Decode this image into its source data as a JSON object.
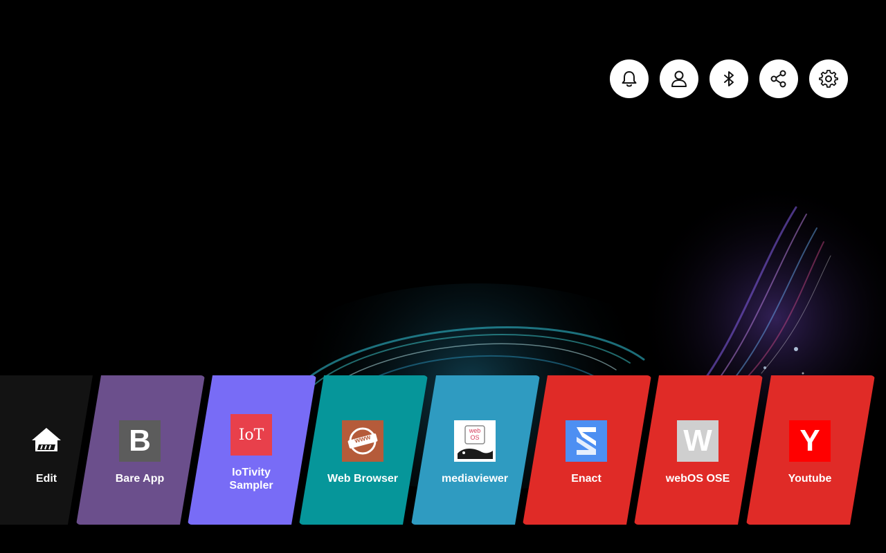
{
  "screen": "webOS launcher home",
  "top_bar": {
    "icons": [
      {
        "name": "notification-bell-icon"
      },
      {
        "name": "user-profile-icon"
      },
      {
        "name": "bluetooth-icon"
      },
      {
        "name": "share-icon"
      },
      {
        "name": "settings-gear-icon"
      }
    ]
  },
  "launcher": {
    "apps": [
      {
        "label": "Edit",
        "color": "#131313",
        "icon": "home-edit-icon"
      },
      {
        "label": "Bare App",
        "color": "#6b4f8c",
        "icon": "bare-app-b-icon",
        "icon_text": "B",
        "icon_bg": "#5c5c5c"
      },
      {
        "label": "IoTivity\nSampler",
        "color": "#786cf6",
        "icon": "iotivity-icon",
        "icon_text": "IoT",
        "icon_bg": "#e8404b"
      },
      {
        "label": "Web Browser",
        "color": "#06969a",
        "icon": "web-browser-icon",
        "icon_text": "www",
        "icon_bg": "#b55b3a"
      },
      {
        "label": "mediaviewer",
        "color": "#2f9bc1",
        "icon": "mediaviewer-icon",
        "icon_text": "web\nOS",
        "icon_bg": "#ffffff"
      },
      {
        "label": "Enact",
        "color": "#e02b27",
        "icon": "enact-icon",
        "icon_bg": "#4d8ff2"
      },
      {
        "label": "webOS OSE",
        "color": "#e02b27",
        "icon": "webos-ose-w-icon",
        "icon_text": "W",
        "icon_bg": "#cfcfcf"
      },
      {
        "label": "Youtube",
        "color": "#e02b27",
        "icon": "youtube-y-icon",
        "icon_text": "Y",
        "icon_bg": "#ff0000"
      }
    ]
  }
}
